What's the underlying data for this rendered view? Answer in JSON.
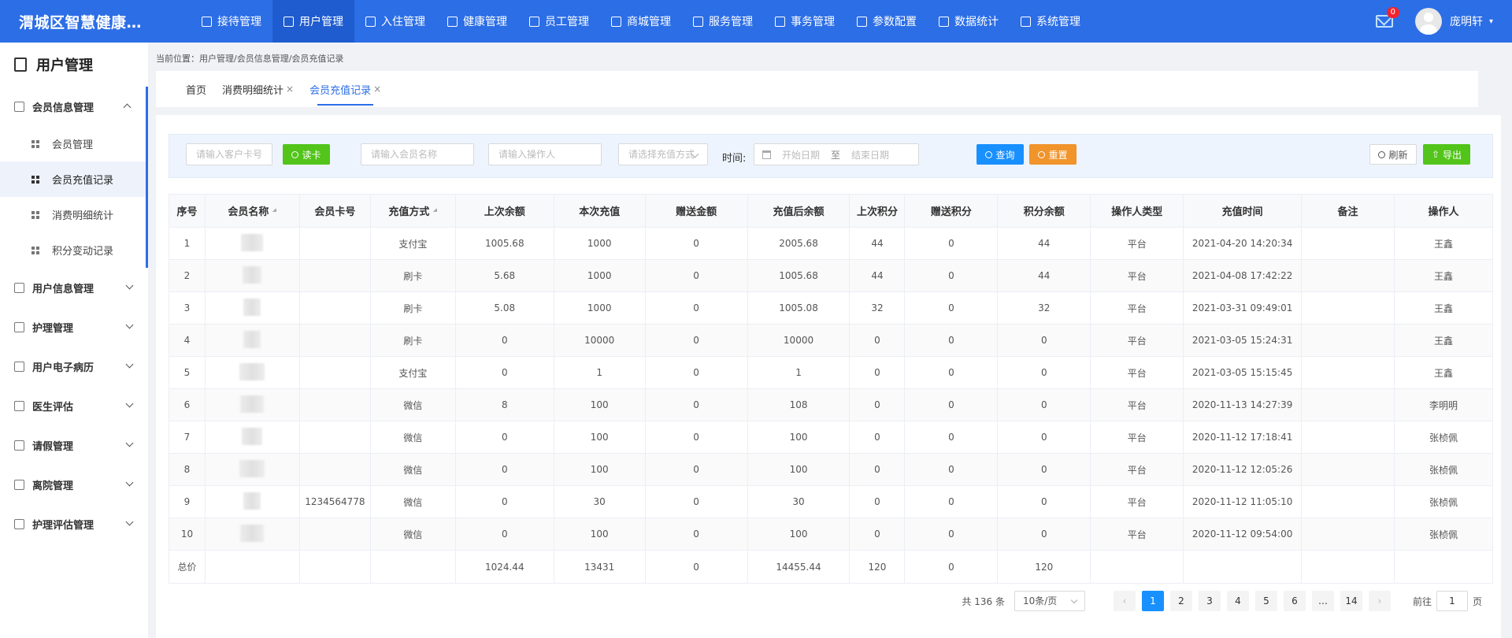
{
  "header": {
    "app_title": "渭城区智慧健康…",
    "nav": [
      "接待管理",
      "用户管理",
      "入住管理",
      "健康管理",
      "员工管理",
      "商城管理",
      "服务管理",
      "事务管理",
      "参数配置",
      "数据统计",
      "系统管理"
    ],
    "mail_count": "0",
    "user_name": "庞明轩"
  },
  "sidebar": {
    "title": "用户管理",
    "groups": [
      {
        "label": "会员信息管理",
        "subs": [
          "会员管理",
          "会员充值记录",
          "消费明细统计",
          "积分变动记录"
        ]
      },
      {
        "label": "用户信息管理"
      },
      {
        "label": "护理管理"
      },
      {
        "label": "用户电子病历"
      },
      {
        "label": "医生评估"
      },
      {
        "label": "请假管理"
      },
      {
        "label": "离院管理"
      },
      {
        "label": "护理评估管理"
      }
    ]
  },
  "breadcrumb": "当前位置：用户管理/会员信息管理/会员充值记录",
  "tabs": [
    {
      "label": "首页"
    },
    {
      "label": "消费明细统计",
      "close": "×"
    },
    {
      "label": "会员充值记录",
      "close": "×"
    }
  ],
  "filter": {
    "card_placeholder": "请输入客户卡号",
    "read_card": "读卡",
    "name_placeholder": "请输入会员名称",
    "operator_placeholder": "请输入操作人",
    "method_placeholder": "请选择充值方式",
    "time_label": "时间:",
    "start_placeholder": "开始日期",
    "range_sep": "至",
    "end_placeholder": "结束日期",
    "search": "查询",
    "reset": "重置",
    "refresh": "刷新",
    "export": "导出"
  },
  "table": {
    "columns": [
      "序号",
      "会员名称",
      "会员卡号",
      "充值方式",
      "上次余额",
      "本次充值",
      "赠送金额",
      "充值后余额",
      "上次积分",
      "赠送积分",
      "积分余额",
      "操作人类型",
      "充值时间",
      "备注",
      "操作人"
    ],
    "rows": [
      [
        "1",
        "",
        "",
        "支付宝",
        "1005.68",
        "1000",
        "0",
        "2005.68",
        "44",
        "0",
        "44",
        "平台",
        "2021-04-20 14:20:34",
        "",
        "王鑫"
      ],
      [
        "2",
        "",
        "",
        "刷卡",
        "5.68",
        "1000",
        "0",
        "1005.68",
        "44",
        "0",
        "44",
        "平台",
        "2021-04-08 17:42:22",
        "",
        "王鑫"
      ],
      [
        "3",
        "",
        "",
        "刷卡",
        "5.08",
        "1000",
        "0",
        "1005.08",
        "32",
        "0",
        "32",
        "平台",
        "2021-03-31 09:49:01",
        "",
        "王鑫"
      ],
      [
        "4",
        "",
        "",
        "刷卡",
        "0",
        "10000",
        "0",
        "10000",
        "0",
        "0",
        "0",
        "平台",
        "2021-03-05 15:24:31",
        "",
        "王鑫"
      ],
      [
        "5",
        "",
        "",
        "支付宝",
        "0",
        "1",
        "0",
        "1",
        "0",
        "0",
        "0",
        "平台",
        "2021-03-05 15:15:45",
        "",
        "王鑫"
      ],
      [
        "6",
        "",
        "",
        "微信",
        "8",
        "100",
        "0",
        "108",
        "0",
        "0",
        "0",
        "平台",
        "2020-11-13 14:27:39",
        "",
        "李明明"
      ],
      [
        "7",
        "",
        "",
        "微信",
        "0",
        "100",
        "0",
        "100",
        "0",
        "0",
        "0",
        "平台",
        "2020-11-12 17:18:41",
        "",
        "张桢佩"
      ],
      [
        "8",
        "",
        "",
        "微信",
        "0",
        "100",
        "0",
        "100",
        "0",
        "0",
        "0",
        "平台",
        "2020-11-12 12:05:26",
        "",
        "张桢佩"
      ],
      [
        "9",
        "",
        "1234564778",
        "微信",
        "0",
        "30",
        "0",
        "30",
        "0",
        "0",
        "0",
        "平台",
        "2020-11-12 11:05:10",
        "",
        "张桢佩"
      ],
      [
        "10",
        "",
        "",
        "微信",
        "0",
        "100",
        "0",
        "100",
        "0",
        "0",
        "0",
        "平台",
        "2020-11-12 09:54:00",
        "",
        "张桢佩"
      ]
    ],
    "total": [
      "总价",
      "",
      "",
      "",
      "1024.44",
      "13431",
      "0",
      "14455.44",
      "120",
      "0",
      "120",
      "",
      "",
      "",
      ""
    ]
  },
  "pagination": {
    "total": "共 136 条",
    "page_size": "10条/页",
    "pages": [
      "1",
      "2",
      "3",
      "4",
      "5",
      "6",
      "…",
      "14"
    ],
    "current": "1",
    "goto_label": "前往",
    "goto_value": "1",
    "page_unit": "页"
  },
  "colors": {
    "primary": "#2c6ee6",
    "success": "#52c41a",
    "warning": "#f0942b",
    "info": "#1890ff"
  }
}
